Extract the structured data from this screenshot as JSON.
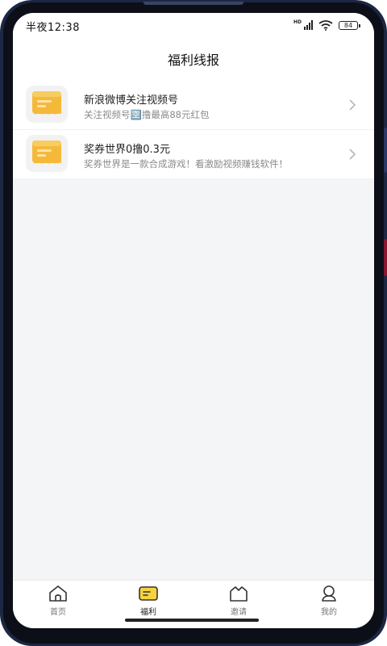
{
  "status_bar": {
    "time": "半夜12:38",
    "network_badge": "HD",
    "battery_level": "84"
  },
  "header": {
    "title": "福利线报"
  },
  "list": [
    {
      "title": "新浪微博关注视频号",
      "description": "关注视频号🈳撸最高88元红包",
      "icon": "ticket-icon"
    },
    {
      "title": "奖券世界0撸0.3元",
      "description": "奖券世界是一款合成游戏！看激励视频赚钱软件！",
      "icon": "ticket-icon"
    }
  ],
  "tabbar": {
    "active_tab": "福利",
    "tabs": [
      {
        "label": "首页",
        "icon": "home-icon"
      },
      {
        "label": "福利",
        "icon": "welfare-icon"
      },
      {
        "label": "邀请",
        "icon": "invite-icon"
      },
      {
        "label": "我的",
        "icon": "profile-icon"
      }
    ]
  },
  "colors": {
    "accent_yellow": "#f5b93a",
    "active_tab_yellow": "#f7d23e",
    "text_primary": "#222222",
    "text_secondary": "#8a8a8a"
  }
}
